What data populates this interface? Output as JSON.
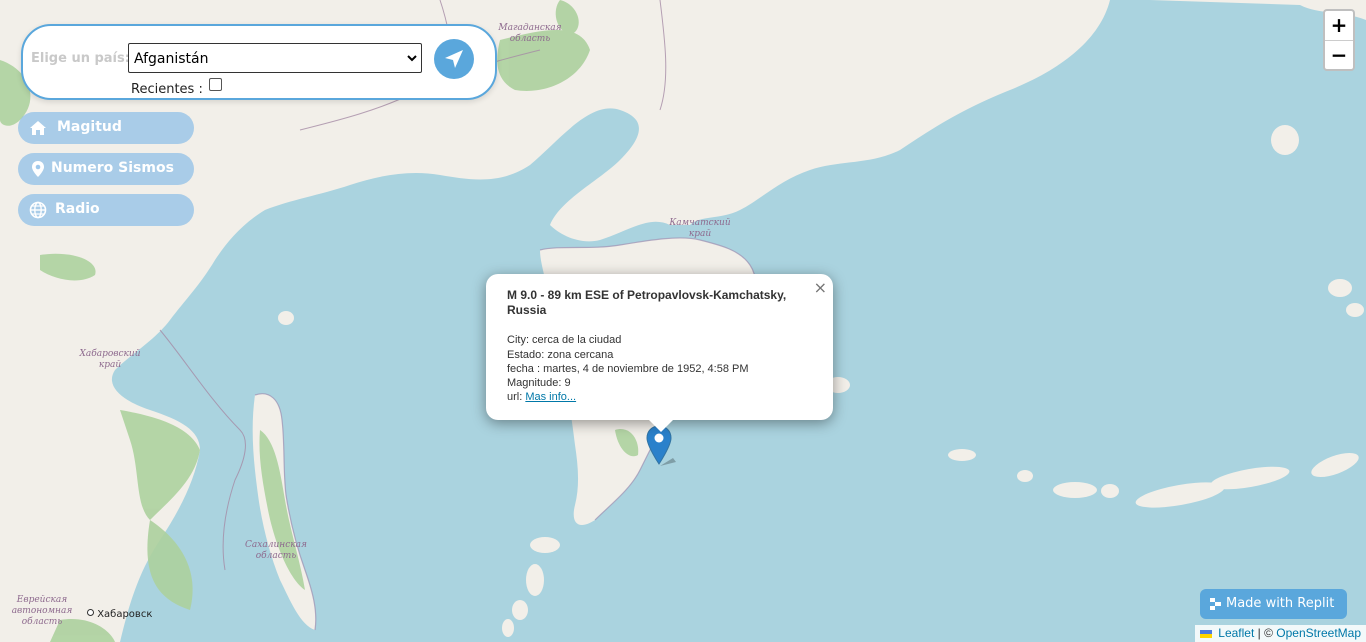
{
  "panel": {
    "label": "Elige un país:",
    "selected_country": "Afganistán",
    "recent_label": "Recientes :",
    "recent_checked": false,
    "go_icon": "navigation-arrow-icon"
  },
  "menu": [
    {
      "label": "Magitud",
      "icon": "home-icon"
    },
    {
      "label": "Numero Sismos",
      "icon": "map-pin-icon"
    },
    {
      "label": "Radio",
      "icon": "globe-icon"
    }
  ],
  "zoom": {
    "in": "+",
    "out": "−"
  },
  "popup": {
    "title": "M 9.0 - 89 km ESE of Petropavlovsk-Kamchatsky, Russia",
    "city": "City: cerca de la ciudad",
    "estado": "Estado: zona cercana",
    "fecha": "fecha : martes, 4 de noviembre de 1952, 4:58 PM",
    "magnitude": "Magnitude: 9",
    "url_prefix": "url:",
    "url_text": "Mas info...",
    "close": "×"
  },
  "map_labels": {
    "magadan_1": "Магаданская",
    "magadan_2": "область",
    "kamchatka_1": "Камчатский",
    "kamchatka_2": "край",
    "khabarovsk_1": "Хабаровский",
    "khabarovsk_2": "край",
    "sakhalin_1": "Сахалинская",
    "sakhalin_2": "область",
    "jewish_1": "Еврейская",
    "jewish_2": "автономная",
    "jewish_3": "область",
    "khabarovsk_city": "Хабаровск"
  },
  "replit": {
    "label": "Made with Replit"
  },
  "attribution": {
    "leaflet": "Leaflet",
    "sep": "| ©",
    "osm": "OpenStreetMap"
  },
  "colors": {
    "water": "#aad3df",
    "land": "#f2efe9",
    "forest": "#add19e",
    "accent": "#5aa7dc",
    "marker": "#2a81cb"
  }
}
